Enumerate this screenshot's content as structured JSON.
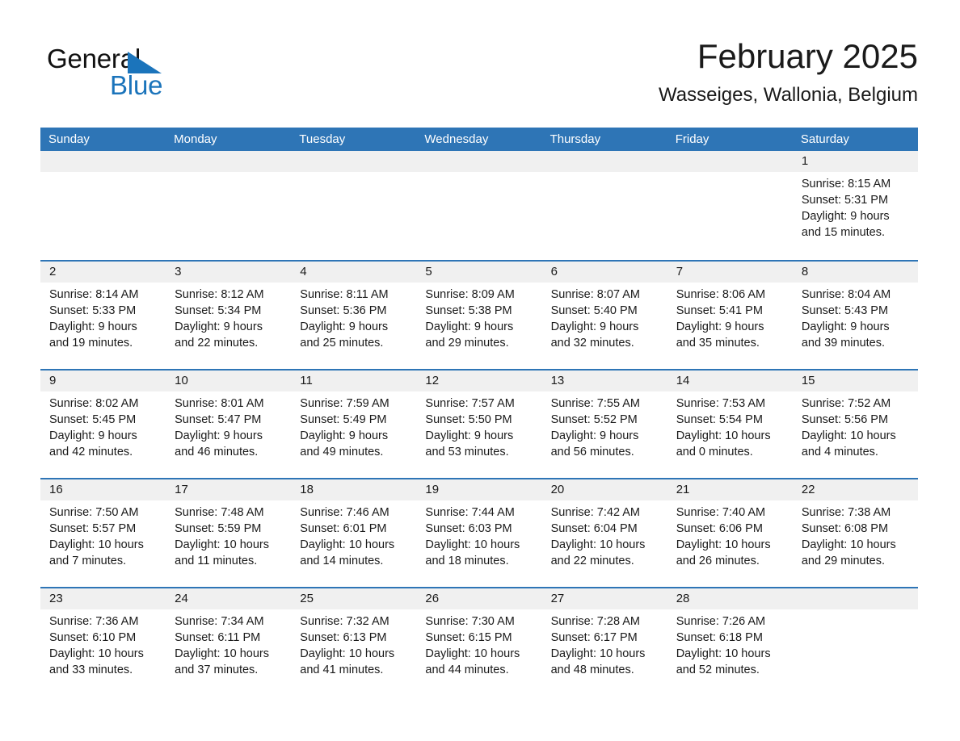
{
  "brand": {
    "name_part1": "General",
    "name_part2": "Blue",
    "accent_color": "#1b74bb"
  },
  "header": {
    "month_title": "February 2025",
    "location": "Wasseiges, Wallonia, Belgium"
  },
  "calendar": {
    "header_bg": "#2e75b6",
    "day_band_bg": "#f0f0f0",
    "weekdays": [
      "Sunday",
      "Monday",
      "Tuesday",
      "Wednesday",
      "Thursday",
      "Friday",
      "Saturday"
    ],
    "weeks": [
      [
        {
          "empty": true
        },
        {
          "empty": true
        },
        {
          "empty": true
        },
        {
          "empty": true
        },
        {
          "empty": true
        },
        {
          "empty": true
        },
        {
          "day": "1",
          "sunrise": "Sunrise: 8:15 AM",
          "sunset": "Sunset: 5:31 PM",
          "daylight": "Daylight: 9 hours and 15 minutes."
        }
      ],
      [
        {
          "day": "2",
          "sunrise": "Sunrise: 8:14 AM",
          "sunset": "Sunset: 5:33 PM",
          "daylight": "Daylight: 9 hours and 19 minutes."
        },
        {
          "day": "3",
          "sunrise": "Sunrise: 8:12 AM",
          "sunset": "Sunset: 5:34 PM",
          "daylight": "Daylight: 9 hours and 22 minutes."
        },
        {
          "day": "4",
          "sunrise": "Sunrise: 8:11 AM",
          "sunset": "Sunset: 5:36 PM",
          "daylight": "Daylight: 9 hours and 25 minutes."
        },
        {
          "day": "5",
          "sunrise": "Sunrise: 8:09 AM",
          "sunset": "Sunset: 5:38 PM",
          "daylight": "Daylight: 9 hours and 29 minutes."
        },
        {
          "day": "6",
          "sunrise": "Sunrise: 8:07 AM",
          "sunset": "Sunset: 5:40 PM",
          "daylight": "Daylight: 9 hours and 32 minutes."
        },
        {
          "day": "7",
          "sunrise": "Sunrise: 8:06 AM",
          "sunset": "Sunset: 5:41 PM",
          "daylight": "Daylight: 9 hours and 35 minutes."
        },
        {
          "day": "8",
          "sunrise": "Sunrise: 8:04 AM",
          "sunset": "Sunset: 5:43 PM",
          "daylight": "Daylight: 9 hours and 39 minutes."
        }
      ],
      [
        {
          "day": "9",
          "sunrise": "Sunrise: 8:02 AM",
          "sunset": "Sunset: 5:45 PM",
          "daylight": "Daylight: 9 hours and 42 minutes."
        },
        {
          "day": "10",
          "sunrise": "Sunrise: 8:01 AM",
          "sunset": "Sunset: 5:47 PM",
          "daylight": "Daylight: 9 hours and 46 minutes."
        },
        {
          "day": "11",
          "sunrise": "Sunrise: 7:59 AM",
          "sunset": "Sunset: 5:49 PM",
          "daylight": "Daylight: 9 hours and 49 minutes."
        },
        {
          "day": "12",
          "sunrise": "Sunrise: 7:57 AM",
          "sunset": "Sunset: 5:50 PM",
          "daylight": "Daylight: 9 hours and 53 minutes."
        },
        {
          "day": "13",
          "sunrise": "Sunrise: 7:55 AM",
          "sunset": "Sunset: 5:52 PM",
          "daylight": "Daylight: 9 hours and 56 minutes."
        },
        {
          "day": "14",
          "sunrise": "Sunrise: 7:53 AM",
          "sunset": "Sunset: 5:54 PM",
          "daylight": "Daylight: 10 hours and 0 minutes."
        },
        {
          "day": "15",
          "sunrise": "Sunrise: 7:52 AM",
          "sunset": "Sunset: 5:56 PM",
          "daylight": "Daylight: 10 hours and 4 minutes."
        }
      ],
      [
        {
          "day": "16",
          "sunrise": "Sunrise: 7:50 AM",
          "sunset": "Sunset: 5:57 PM",
          "daylight": "Daylight: 10 hours and 7 minutes."
        },
        {
          "day": "17",
          "sunrise": "Sunrise: 7:48 AM",
          "sunset": "Sunset: 5:59 PM",
          "daylight": "Daylight: 10 hours and 11 minutes."
        },
        {
          "day": "18",
          "sunrise": "Sunrise: 7:46 AM",
          "sunset": "Sunset: 6:01 PM",
          "daylight": "Daylight: 10 hours and 14 minutes."
        },
        {
          "day": "19",
          "sunrise": "Sunrise: 7:44 AM",
          "sunset": "Sunset: 6:03 PM",
          "daylight": "Daylight: 10 hours and 18 minutes."
        },
        {
          "day": "20",
          "sunrise": "Sunrise: 7:42 AM",
          "sunset": "Sunset: 6:04 PM",
          "daylight": "Daylight: 10 hours and 22 minutes."
        },
        {
          "day": "21",
          "sunrise": "Sunrise: 7:40 AM",
          "sunset": "Sunset: 6:06 PM",
          "daylight": "Daylight: 10 hours and 26 minutes."
        },
        {
          "day": "22",
          "sunrise": "Sunrise: 7:38 AM",
          "sunset": "Sunset: 6:08 PM",
          "daylight": "Daylight: 10 hours and 29 minutes."
        }
      ],
      [
        {
          "day": "23",
          "sunrise": "Sunrise: 7:36 AM",
          "sunset": "Sunset: 6:10 PM",
          "daylight": "Daylight: 10 hours and 33 minutes."
        },
        {
          "day": "24",
          "sunrise": "Sunrise: 7:34 AM",
          "sunset": "Sunset: 6:11 PM",
          "daylight": "Daylight: 10 hours and 37 minutes."
        },
        {
          "day": "25",
          "sunrise": "Sunrise: 7:32 AM",
          "sunset": "Sunset: 6:13 PM",
          "daylight": "Daylight: 10 hours and 41 minutes."
        },
        {
          "day": "26",
          "sunrise": "Sunrise: 7:30 AM",
          "sunset": "Sunset: 6:15 PM",
          "daylight": "Daylight: 10 hours and 44 minutes."
        },
        {
          "day": "27",
          "sunrise": "Sunrise: 7:28 AM",
          "sunset": "Sunset: 6:17 PM",
          "daylight": "Daylight: 10 hours and 48 minutes."
        },
        {
          "day": "28",
          "sunrise": "Sunrise: 7:26 AM",
          "sunset": "Sunset: 6:18 PM",
          "daylight": "Daylight: 10 hours and 52 minutes."
        },
        {
          "empty": true
        }
      ]
    ]
  }
}
